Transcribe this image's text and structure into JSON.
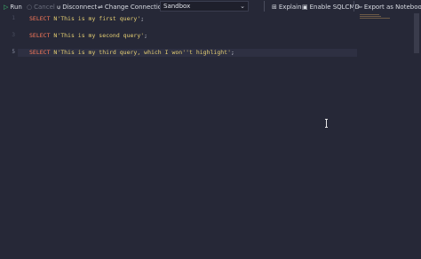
{
  "toolbar": {
    "run_label": "Run",
    "cancel_label": "Cancel",
    "disconnect_label": "Disconnect",
    "change_connection_label": "Change Connection",
    "database_selected": "Sandbox",
    "explain_label": "Explain",
    "sqlcmd_label": "Enable SQLCMD",
    "export_label": "Export as Notebook"
  },
  "editor": {
    "lines": [
      {
        "number": "1",
        "keyword": "SELECT",
        "string": "N'This is my first query'",
        "end": ";"
      },
      {
        "number": "3",
        "keyword": "SELECT",
        "string": "N'This is my second query'",
        "end": ";"
      },
      {
        "number": "5",
        "keyword": "SELECT",
        "string": "N'This is my third query, which I won''t highlight'",
        "end": ";"
      }
    ]
  },
  "colors": {
    "background": "#262837",
    "keyword": "#ff7a59",
    "string": "#e6cf73",
    "run_icon": "#3fbf6f"
  },
  "icons": [
    "play-icon",
    "cancel-icon",
    "disconnect-icon",
    "change-connection-icon",
    "chevron-down-icon",
    "explain-icon",
    "sqlcmd-icon",
    "export-icon"
  ]
}
